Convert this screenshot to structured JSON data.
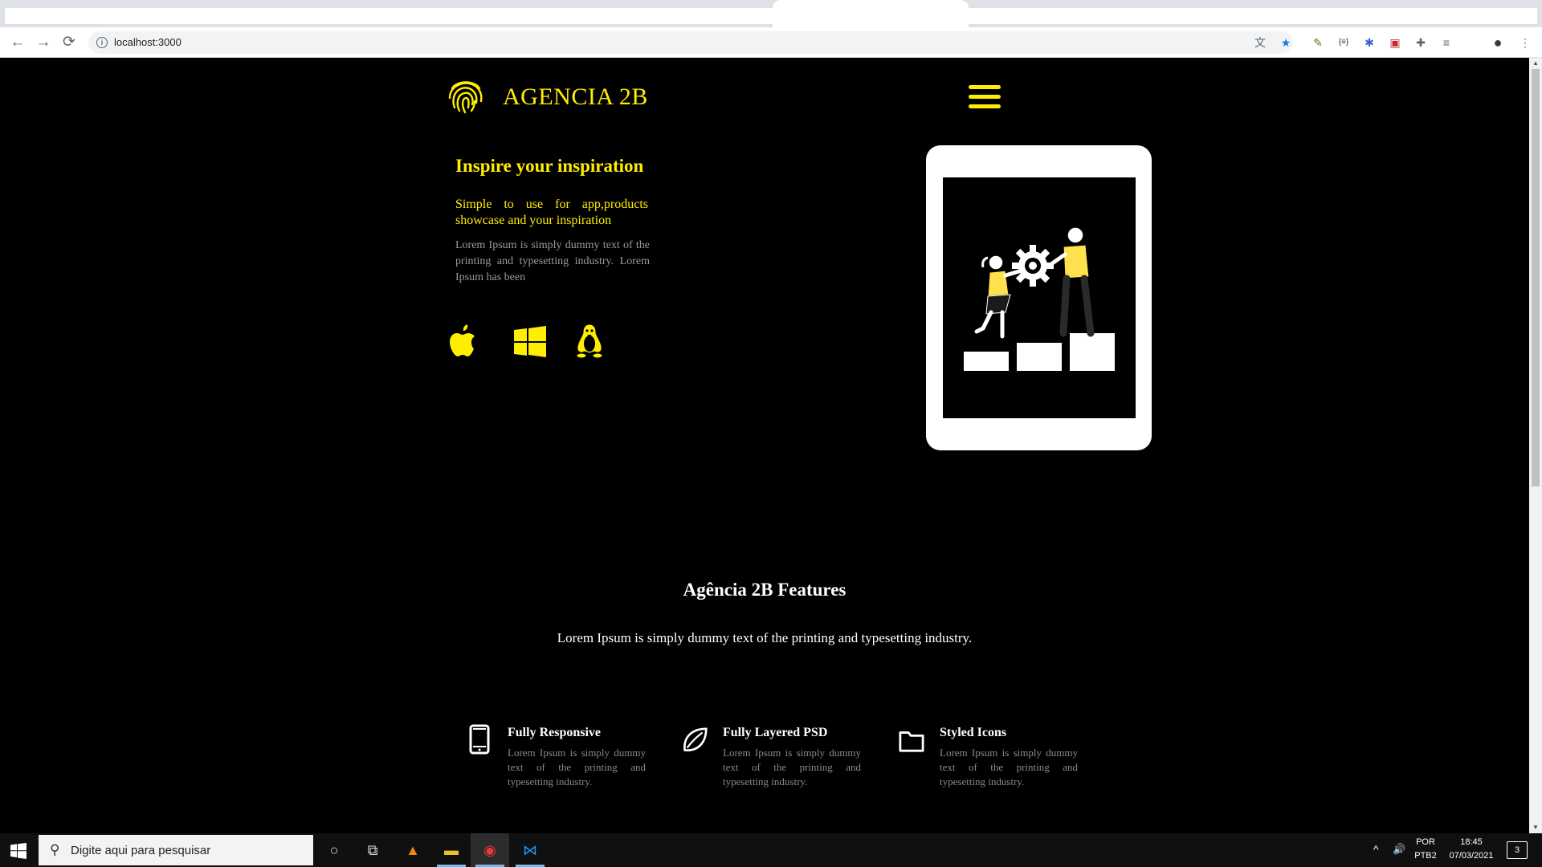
{
  "browser": {
    "url": "localhost:3000",
    "nav": {
      "back": "←",
      "forward": "→",
      "reload": "⟳",
      "menu": "⋮"
    },
    "info": "i",
    "extensions": [
      "translate-icon",
      "bookmark-star-icon",
      "pencil-extension-icon",
      "json-extension-icon",
      "react-devtools-icon",
      "red-extension-icon",
      "puzzle-extension-icon",
      "reading-list-icon",
      "profile-avatar-icon"
    ],
    "ext_glyphs": [
      "文",
      "★",
      "✎",
      "{≡}",
      "✱",
      "▣",
      "✚",
      "≡",
      "●"
    ]
  },
  "page": {
    "brand": "AGENCIA 2B",
    "hero": {
      "title": "Inspire your inspiration",
      "subtitle": "Simple to use for app,products showcase and your inspiration",
      "description": "Lorem Ipsum is simply dummy text of the printing and typesetting industry. Lorem Ipsum has been"
    },
    "platform_icons": [
      "apple-icon",
      "windows-icon",
      "linux-tux-icon"
    ],
    "features": {
      "title": "Agência 2B Features",
      "subtitle": "Lorem Ipsum is simply dummy text of the printing and typesetting industry.",
      "items": [
        {
          "icon": "tablet-icon",
          "name": "Fully Responsive",
          "desc": "Lorem Ipsum is simply dummy text of the printing and typesetting industry."
        },
        {
          "icon": "leaf-icon",
          "name": "Fully Layered PSD",
          "desc": "Lorem Ipsum is simply dummy text of the printing and typesetting industry."
        },
        {
          "icon": "folder-icon",
          "name": "Styled Icons",
          "desc": "Lorem Ipsum is simply dummy text of the printing and typesetting industry."
        }
      ]
    },
    "colors": {
      "accent": "#ffee00",
      "background": "#000000",
      "muted_text": "#9a9a9a"
    }
  },
  "taskbar": {
    "search_placeholder": "Digite aqui para pesquisar",
    "apps": [
      "cortana-icon",
      "task-view-icon",
      "vlc-icon",
      "file-explorer-icon",
      "chrome-icon",
      "vscode-icon"
    ],
    "app_glyphs": [
      "○",
      "⧉",
      "▲",
      "▬",
      "◉",
      "⋈"
    ],
    "tray": {
      "chevron": "^",
      "volume": "🔊",
      "lang_top": "POR",
      "lang_bottom": "PTB2",
      "time": "18:45",
      "date": "07/03/2021",
      "notifications": "3"
    }
  }
}
